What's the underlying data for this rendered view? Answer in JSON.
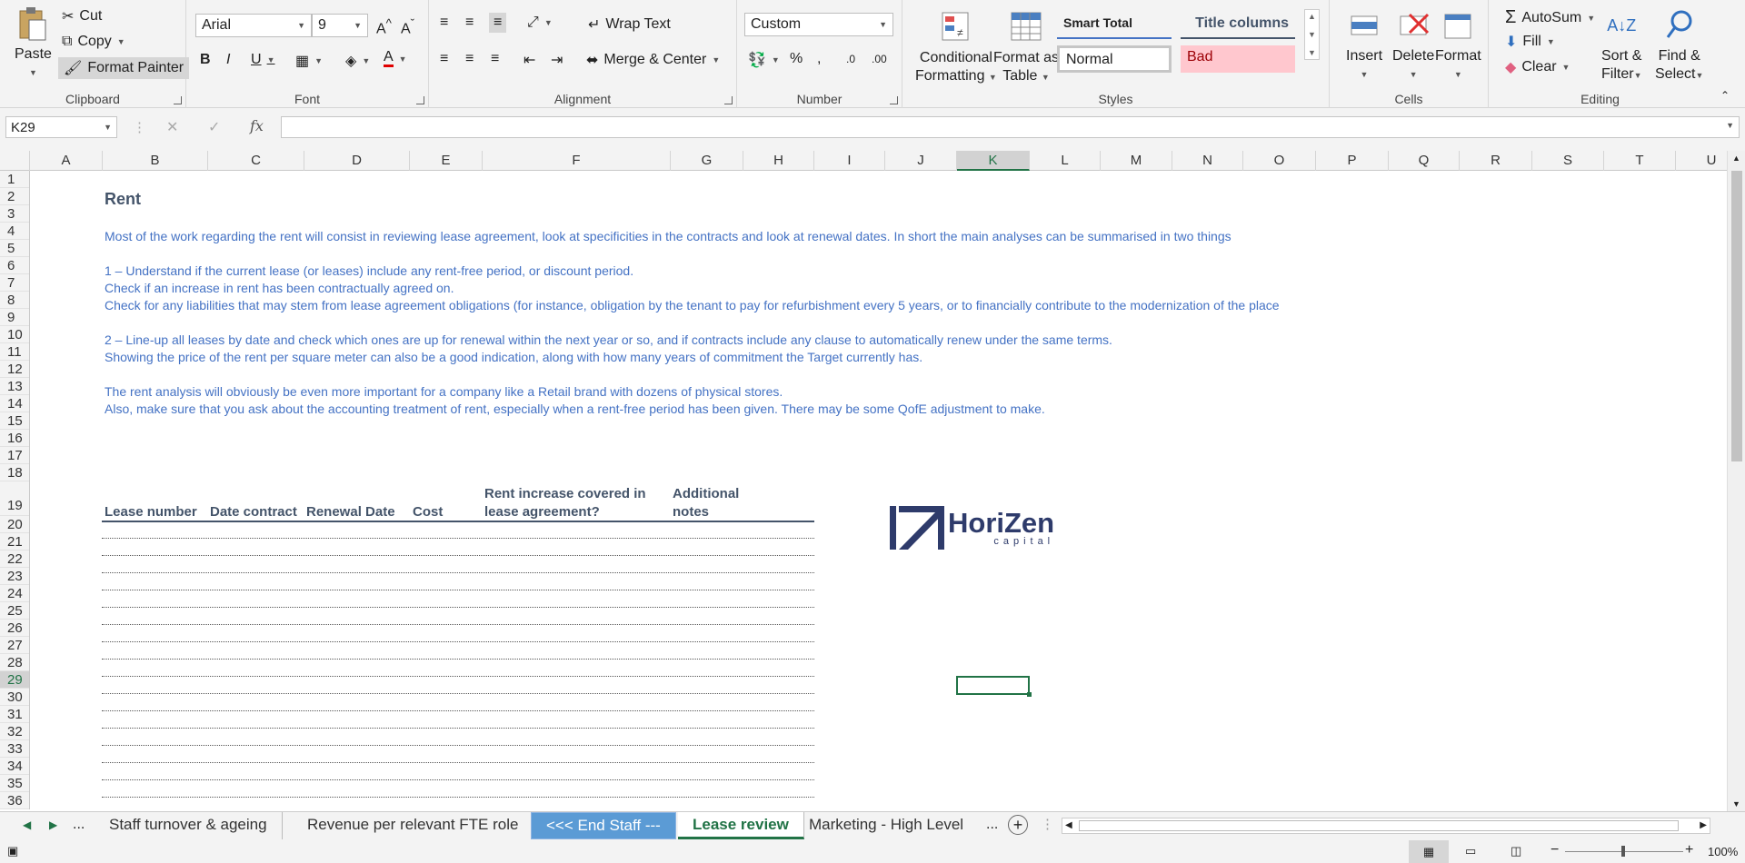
{
  "ribbon": {
    "clipboard": {
      "paste": "Paste",
      "cut": "Cut",
      "copy": "Copy",
      "format_painter": "Format Painter",
      "label": "Clipboard"
    },
    "font": {
      "font_name": "Arial",
      "font_size": "9",
      "bold": "B",
      "italic": "I",
      "underline": "U",
      "label": "Font",
      "font_color": "#e00000"
    },
    "alignment": {
      "wrap_text": "Wrap Text",
      "merge_center": "Merge & Center",
      "label": "Alignment"
    },
    "number": {
      "format": "Custom",
      "percent": "%",
      "comma": ",",
      "label": "Number"
    },
    "styles": {
      "conditional": "Conditional",
      "formatting": "Formatting",
      "format_as": "Format as",
      "table": "Table",
      "smart_total": "Smart Total",
      "title_columns": "Title columns",
      "normal": "Normal",
      "bad": "Bad",
      "label": "Styles"
    },
    "cells": {
      "insert": "Insert",
      "delete": "Delete",
      "format": "Format",
      "label": "Cells"
    },
    "editing": {
      "autosum": "AutoSum",
      "fill": "Fill",
      "clear": "Clear",
      "sort_filter_1": "Sort &",
      "sort_filter_2": "Filter",
      "find_select_1": "Find &",
      "find_select_2": "Select",
      "label": "Editing"
    }
  },
  "formula_bar": {
    "name_box": "K29",
    "fx": "fx",
    "content": ""
  },
  "columns": [
    "A",
    "B",
    "C",
    "D",
    "E",
    "F",
    "G",
    "H",
    "I",
    "J",
    "K",
    "L",
    "M",
    "N",
    "O",
    "P",
    "Q",
    "R",
    "S",
    "T",
    "U"
  ],
  "selected_column": "K",
  "rows": [
    "1",
    "2",
    "3",
    "4",
    "5",
    "6",
    "7",
    "8",
    "9",
    "10",
    "11",
    "12",
    "13",
    "14",
    "15",
    "16",
    "17",
    "18",
    "19",
    "20",
    "21",
    "22",
    "23",
    "24",
    "25",
    "26",
    "27",
    "28",
    "29",
    "30",
    "31",
    "32",
    "33",
    "34",
    "35",
    "36"
  ],
  "selected_row": "29",
  "sheet": {
    "title": "Rent",
    "lines": [
      "Most of the work regarding the rent will consist in reviewing lease agreement, look at specificities in the contracts and look at renewal dates. In short the main analyses can be summarised in two things",
      "1 – Understand if the current lease (or leases) include any rent-free period, or discount period.",
      "Check if an increase in rent has been contractually agreed on.",
      "Check for any liabilities that may stem from lease agreement obligations (for instance, obligation by the tenant to pay for refurbishment every 5 years, or to financially contribute to the modernization of the place",
      "2 – Line-up all leases by date and check which ones are up for renewal within the next year or so, and if contracts include any clause to automatically renew under the same terms.",
      "Showing the price of the rent per square meter can also be a good indication, along with how many years of commitment the Target currently has.",
      "The rent analysis will obviously be even more important for a company like a Retail brand with dozens of physical stores.",
      "Also, make sure that you ask about the accounting treatment of rent, especially when a rent-free period has been given. There may be some QofE adjustment to make."
    ],
    "table_headers": [
      "Lease number",
      "Date contract",
      "Renewal Date",
      "Cost",
      "Rent increase covered in",
      "lease agreement?",
      "Additional",
      "notes"
    ],
    "logo_text": "HoriZen",
    "logo_sub": "capital"
  },
  "tabs": {
    "ellipsis_left": "...",
    "items": [
      "Staff turnover & ageing",
      "Revenue per relevant FTE role",
      "<<< End Staff ---",
      "Lease review",
      "Marketing - High Level"
    ],
    "ellipsis_right": "...",
    "active": "Lease review"
  },
  "status": {
    "zoom": "100%"
  }
}
